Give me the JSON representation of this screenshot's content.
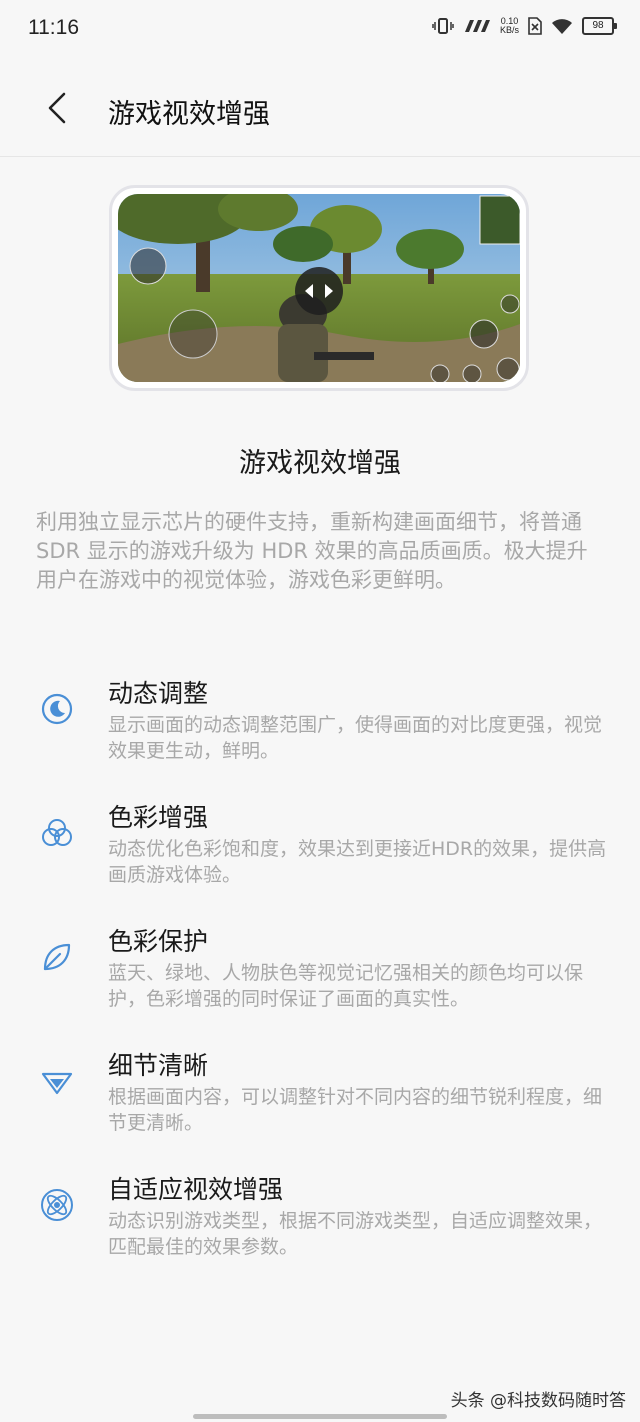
{
  "status_bar": {
    "time": "11:16",
    "net_speed_value": "0.10",
    "net_speed_unit": "KB/s",
    "signal_label": "777",
    "battery": "98"
  },
  "header": {
    "title": "游戏视效增强"
  },
  "preview": {
    "icon": "game-screenshot"
  },
  "intro": {
    "title": "游戏视效增强",
    "description": "利用独立显示芯片的硬件支持，重新构建画面细节，将普通 SDR 显示的游戏升级为 HDR 效果的高品质画质。极大提升用户在游戏中的视觉体验，游戏色彩更鲜明。"
  },
  "features": [
    {
      "icon": "moon-icon",
      "title": "动态调整",
      "desc": "显示画面的动态调整范围广，使得画面的对比度更强，视觉效果更生动，鲜明。"
    },
    {
      "icon": "color-circles-icon",
      "title": "色彩增强",
      "desc": "动态优化色彩饱和度，效果达到更接近HDR的效果，提供高画质游戏体验。"
    },
    {
      "icon": "leaf-icon",
      "title": "色彩保护",
      "desc": "蓝天、绿地、人物肤色等视觉记忆强相关的颜色均可以保护，色彩增强的同时保证了画面的真实性。"
    },
    {
      "icon": "diamond-icon",
      "title": "细节清晰",
      "desc": "根据画面内容，可以调整针对不同内容的细节锐利程度，细节更清晰。"
    },
    {
      "icon": "atom-icon",
      "title": "自适应视效增强",
      "desc": "动态识别游戏类型，根据不同游戏类型，自适应调整效果，匹配最佳的效果参数。"
    }
  ],
  "watermark": "头条 @科技数码随时答",
  "colors": {
    "accent": "#4a8fd6",
    "secondary_text": "#a8a8a8"
  }
}
